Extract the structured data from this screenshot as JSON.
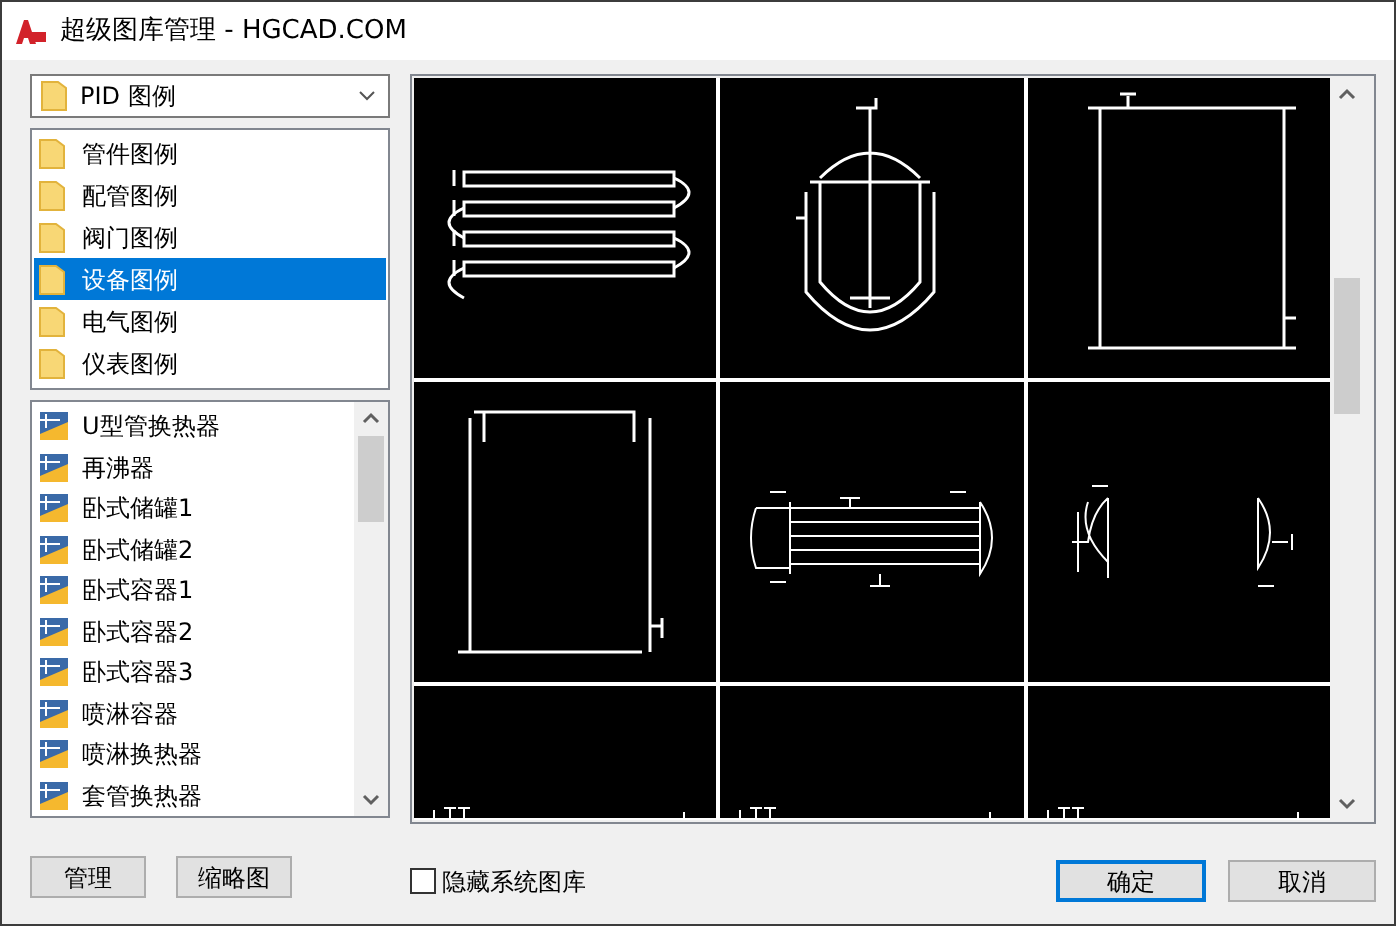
{
  "window": {
    "title": "超级图库管理 - HGCAD.COM"
  },
  "library_dropdown": {
    "value": "PID 图例"
  },
  "categories": [
    {
      "label": "管件图例",
      "selected": false
    },
    {
      "label": "配管图例",
      "selected": false
    },
    {
      "label": "阀门图例",
      "selected": false
    },
    {
      "label": "设备图例",
      "selected": true
    },
    {
      "label": "电气图例",
      "selected": false
    },
    {
      "label": "仪表图例",
      "selected": false
    }
  ],
  "items": [
    "U型管换热器",
    "再沸器",
    "卧式储罐1",
    "卧式储罐2",
    "卧式容器1",
    "卧式容器2",
    "卧式容器3",
    "喷淋容器",
    "喷淋换热器",
    "套管换热器"
  ],
  "thumbnails": [
    {
      "kind": "exchanger-stack"
    },
    {
      "kind": "reactor"
    },
    {
      "kind": "tank"
    },
    {
      "kind": "open-tank"
    },
    {
      "kind": "shell-tube"
    },
    {
      "kind": "heads"
    },
    {
      "kind": "cut"
    },
    {
      "kind": "cut"
    },
    {
      "kind": "cut"
    }
  ],
  "buttons": {
    "manage": "管理",
    "thumbnail": "缩略图",
    "ok": "确定",
    "cancel": "取消"
  },
  "hide_system": {
    "label": "隐藏系统图库",
    "checked": false
  }
}
